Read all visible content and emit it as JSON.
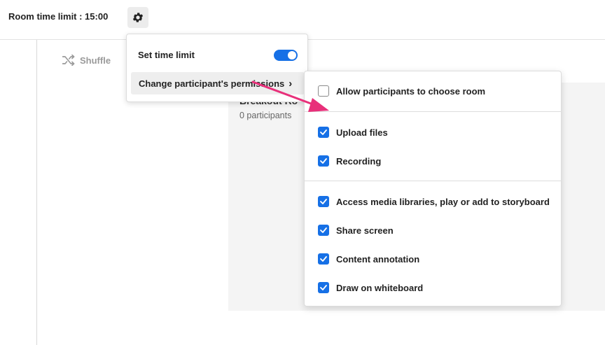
{
  "header": {
    "room_time_limit": "Room time limit : 15:00"
  },
  "toolbar": {
    "shuffle_label": "Shuffle"
  },
  "room_card": {
    "title": "Breakout Ro",
    "participants": "0 participants"
  },
  "settings_menu": {
    "set_time_limit": "Set time limit",
    "set_time_limit_on": true,
    "change_permissions": "Change participant's permissions",
    "chevron": "›"
  },
  "permissions_menu": {
    "allow_choose_room": "Allow participants to choose room",
    "upload_files": "Upload files",
    "recording": "Recording",
    "access_media": "Access media libraries, play or add to storyboard",
    "share_screen": "Share screen",
    "content_annotation": "Content annotation",
    "draw_whiteboard": "Draw on whiteboard"
  },
  "colors": {
    "accent": "#1670e6",
    "arrow": "#e8307a"
  },
  "icons": [
    "gear-icon",
    "shuffle-icon",
    "chevron-right-icon",
    "check-icon"
  ]
}
